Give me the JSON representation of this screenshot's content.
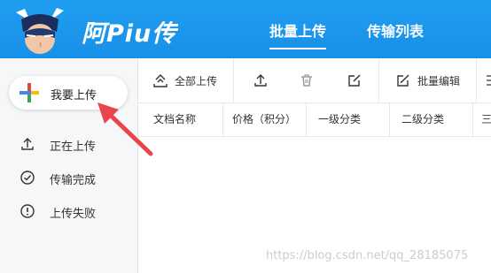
{
  "header": {
    "logo_text": "阿Piu传",
    "tabs": [
      {
        "label": "批量上传",
        "active": true
      },
      {
        "label": "传输列表",
        "active": false
      }
    ],
    "bg_color": "#1890e8"
  },
  "sidebar": {
    "upload_button": {
      "label": "我要上传",
      "icon": "google-plus-icon"
    },
    "items": [
      {
        "label": "正在上传",
        "icon": "upload-icon"
      },
      {
        "label": "传输完成",
        "icon": "check-circle-icon"
      },
      {
        "label": "上传失败",
        "icon": "exclamation-circle-icon"
      }
    ]
  },
  "toolbar": {
    "upload_all_label": "全部上传",
    "batch_edit_label": "批量编辑",
    "buttons": [
      "upload-all-icon",
      "upload-icon",
      "trash-icon",
      "edit-icon",
      "batch-edit-icon"
    ]
  },
  "table": {
    "columns": [
      "文档名称",
      "价格（积分）",
      "一级分类",
      "二级分类",
      "三"
    ]
  },
  "watermark": "https://blog.csdn.net/qq_28185075",
  "colors": {
    "accent": "#1890e8",
    "arrow": "#e8464c"
  }
}
